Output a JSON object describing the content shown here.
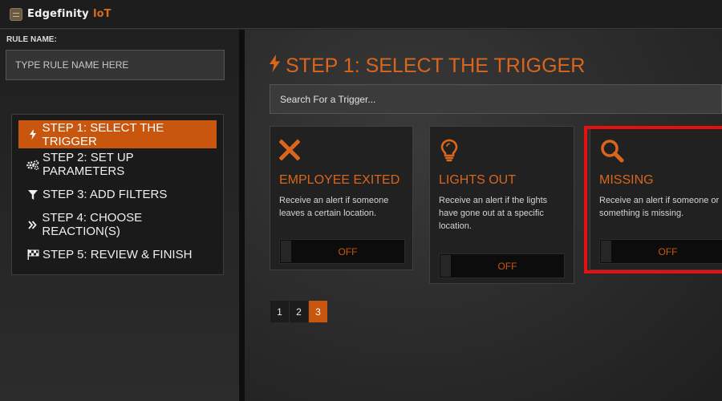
{
  "app": {
    "name": "Edgefinity",
    "name_accent": "IoT"
  },
  "rule": {
    "label": "RULE NAME:",
    "placeholder": "TYPE RULE NAME HERE"
  },
  "steps": [
    {
      "label": "STEP 1: SELECT THE TRIGGER",
      "icon": "bolt-icon",
      "active": true
    },
    {
      "label": "STEP 2: SET UP PARAMETERS",
      "icon": "gears-icon",
      "active": false
    },
    {
      "label": "STEP 3: ADD FILTERS",
      "icon": "filter-icon",
      "active": false
    },
    {
      "label": "STEP 4: CHOOSE REACTION(S)",
      "icon": "double-chevron-right-icon",
      "active": false
    },
    {
      "label": "STEP 5: REVIEW & FINISH",
      "icon": "checkered-flag-icon",
      "active": false
    }
  ],
  "main": {
    "title": "STEP 1: SELECT THE TRIGGER",
    "search_placeholder": "Search For a Trigger..."
  },
  "triggers": [
    {
      "title": "EMPLOYEE EXITED",
      "description": "Receive an alert if someone leaves a certain location.",
      "icon": "x-icon",
      "toggle": "OFF"
    },
    {
      "title": "LIGHTS OUT",
      "description": "Receive an alert if the lights have gone out at a specific location.",
      "icon": "lightbulb-icon",
      "toggle": "OFF"
    },
    {
      "title": "MISSING",
      "description": "Receive an alert if someone or something is missing.",
      "icon": "magnifier-icon",
      "toggle": "OFF",
      "highlighted": true
    }
  ],
  "pagination": {
    "pages": [
      "1",
      "2",
      "3"
    ],
    "current": "3"
  },
  "colors": {
    "accent": "#d9661c",
    "active_bg": "#c8560f",
    "highlight": "#e80f0f"
  }
}
